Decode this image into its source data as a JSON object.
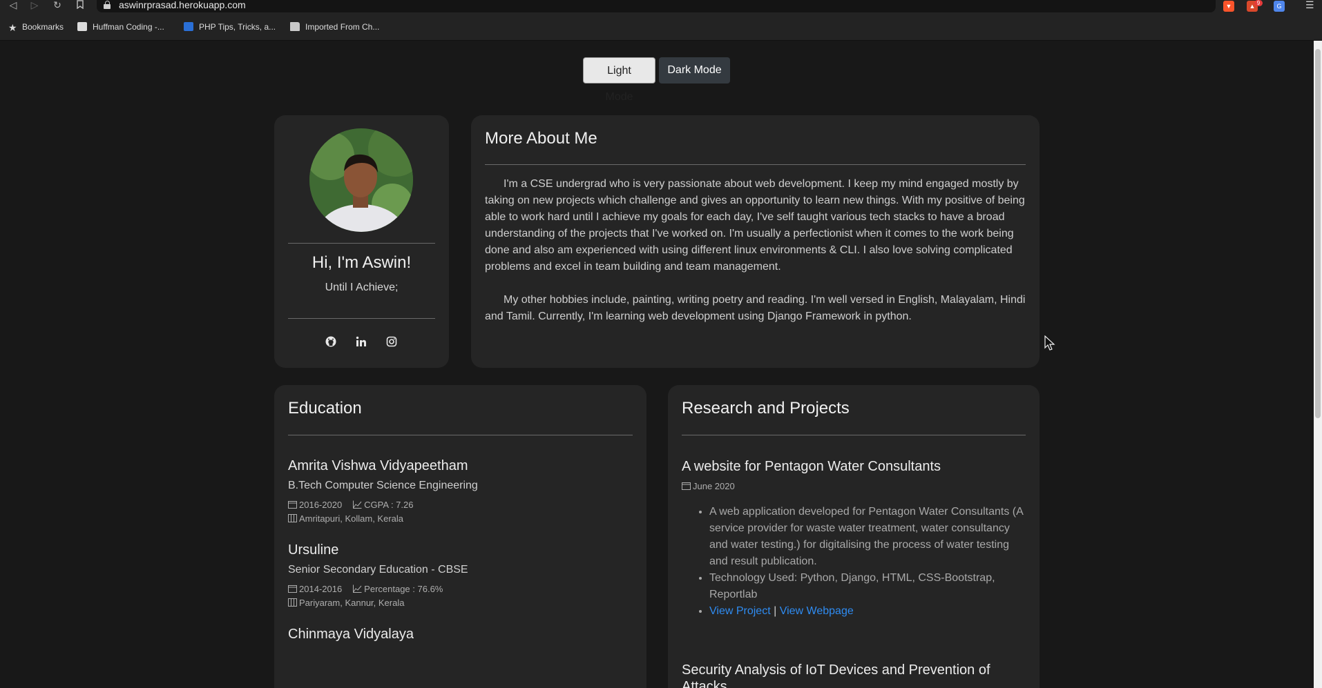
{
  "browser": {
    "url": "aswinrprasad.herokuapp.com",
    "ext_badge": "9",
    "bookmarks": [
      {
        "label": "Bookmarks"
      },
      {
        "label": "Huffman Coding -..."
      },
      {
        "label": "PHP Tips, Tricks, a..."
      },
      {
        "label": "Imported From Ch..."
      }
    ]
  },
  "theme": {
    "light_label": "Light Mode",
    "dark_label": "Dark Mode"
  },
  "profile": {
    "greeting": "Hi, I'm Aswin!",
    "motto": "Until I Achieve;"
  },
  "about": {
    "title": "More About Me",
    "para1": "I'm a CSE undergrad who is very passionate about web development. I keep my mind engaged mostly by taking on new projects which challenge and gives an opportunity to learn new things. With my positive of being able to work hard until I achieve my goals for each day, I've self taught various tech stacks to have a broad understanding of the projects that I've worked on. I'm usually a perfectionist when it comes to the work being done and also am experienced with using different linux environments & CLI. I also love solving complicated problems and excel in team building and team management.",
    "para2": "My other hobbies include, painting, writing poetry and reading. I'm well versed in English, Malayalam, Hindi and Tamil. Currently, I'm learning web development using Django Framework in python."
  },
  "education": {
    "title": "Education",
    "items": [
      {
        "name": "Amrita Vishwa Vidyapeetham",
        "degree": "B.Tech Computer Science Engineering",
        "years": "2016-2020",
        "score": "CGPA : 7.26",
        "place": "Amritapuri, Kollam, Kerala"
      },
      {
        "name": "Ursuline",
        "degree": "Senior Secondary Education - CBSE",
        "years": "2014-2016",
        "score": "Percentage : 76.6%",
        "place": "Pariyaram, Kannur, Kerala"
      },
      {
        "name": "Chinmaya Vidyalaya"
      }
    ]
  },
  "projects": {
    "title": "Research and Projects",
    "items": [
      {
        "title": "A website for Pentagon Water Consultants",
        "date": "June 2020",
        "bullets": [
          "A web application developed for Pentagon Water Consultants (A service provider for waste water treatment, water consultancy and water testing.) for digitalising the process of water testing and result publication.",
          "Technology Used: Python, Django, HTML, CSS-Bootstrap, Reportlab"
        ],
        "link1": "View Project",
        "separator": "|",
        "link2": "View Webpage"
      },
      {
        "title": "Security Analysis of IoT Devices and Prevention of Attacks"
      }
    ]
  }
}
